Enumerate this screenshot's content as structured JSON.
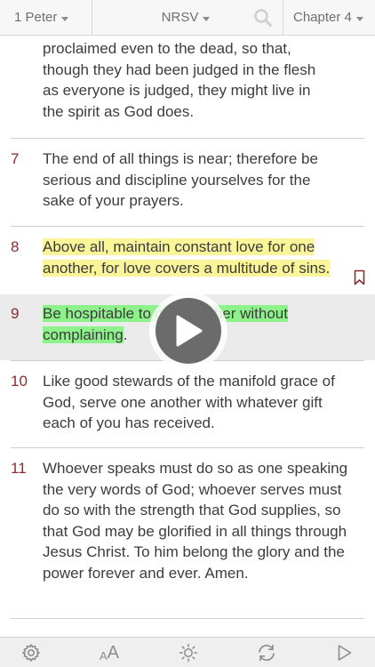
{
  "topbar": {
    "book": "1 Peter",
    "version": "NRSV",
    "chapter": "Chapter 4"
  },
  "verses": [
    {
      "number": "",
      "text": "proclaimed even to the dead, so that, though they had been judged in the flesh as everyone is judged, they might live in the spirit as God does."
    },
    {
      "number": "7",
      "text": "The end of all things is near; therefore be serious and discipline yourselves for the sake of your prayers."
    },
    {
      "number": "8",
      "text_lines": [
        "Above all, maintain constant love for one",
        "another, for love covers a multitude of sins."
      ]
    },
    {
      "number": "9",
      "text_lines": [
        "Be hospitable to one another without",
        "complaining"
      ],
      "trailing": "."
    },
    {
      "number": "10",
      "text": "Like good stewards of the manifold grace of God, serve one another with whatever gift each of you has received."
    },
    {
      "number": "11",
      "text": "Whoever speaks must do so as one speaking the very words of God; whoever serves must do so with the strength that God supplies, so that God may be glorified in all things through Jesus Christ. To him belong the glory and the power forever and ever. Amen."
    }
  ],
  "bottombar": {
    "font_size_label_small": "A",
    "font_size_label_large": "A"
  },
  "colors": {
    "verse_number": "#8d2b2b",
    "highlight_yellow": "#fbf59a",
    "highlight_green": "#8ef28a",
    "bookmark": "#8d2b2b"
  }
}
